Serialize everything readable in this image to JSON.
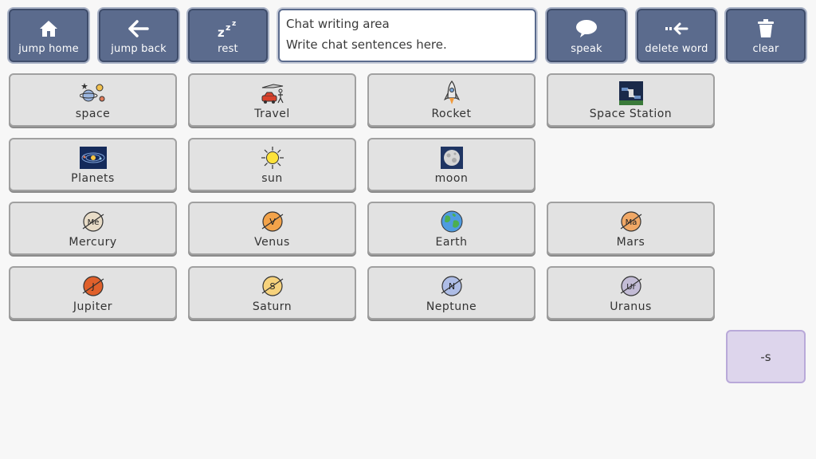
{
  "toolbar": {
    "jump_home": {
      "label": "jump home",
      "icon": "home-icon"
    },
    "jump_back": {
      "label": "jump back",
      "icon": "arrow-left-icon"
    },
    "rest": {
      "label": "rest",
      "icon": "zzz-icon"
    },
    "speak": {
      "label": "speak",
      "icon": "speech-bubble-icon"
    },
    "delete_word": {
      "label": "delete word",
      "icon": "delete-word-icon"
    },
    "clear": {
      "label": "clear",
      "icon": "trash-icon"
    }
  },
  "chat": {
    "title": "Chat writing area",
    "placeholder": "Write chat sentences here."
  },
  "grid": {
    "space": {
      "label": "space",
      "icon": "space-icon"
    },
    "travel": {
      "label": "Travel",
      "icon": "travel-icon"
    },
    "rocket": {
      "label": "Rocket",
      "icon": "rocket-icon"
    },
    "space_station": {
      "label": "Space Station",
      "icon": "space-station-icon"
    },
    "planets": {
      "label": "Planets",
      "icon": "solar-system-icon"
    },
    "sun": {
      "label": "sun",
      "icon": "sun-icon"
    },
    "moon": {
      "label": "moon",
      "icon": "moon-icon"
    },
    "mercury": {
      "label": "Mercury",
      "abbr": "Me",
      "icon": "planet-mercury-icon"
    },
    "venus": {
      "label": "Venus",
      "abbr": "V",
      "icon": "planet-venus-icon"
    },
    "earth": {
      "label": "Earth",
      "icon": "earth-icon"
    },
    "mars": {
      "label": "Mars",
      "abbr": "Ma",
      "icon": "planet-mars-icon"
    },
    "jupiter": {
      "label": "Jupiter",
      "abbr": "J",
      "icon": "planet-jupiter-icon"
    },
    "saturn": {
      "label": "Saturn",
      "abbr": "S",
      "icon": "planet-saturn-icon"
    },
    "neptune": {
      "label": "Neptune",
      "abbr": "N",
      "icon": "planet-neptune-icon"
    },
    "uranus": {
      "label": "Uranus",
      "abbr": "Ur",
      "icon": "planet-uranus-icon"
    }
  },
  "suffix": {
    "label": "-s"
  },
  "colors": {
    "toolbar_bg": "#5b6b8d",
    "tile_bg": "#e2e2e2",
    "suffix_bg": "#ddd5ec",
    "page_bg": "#f7f7f7"
  }
}
